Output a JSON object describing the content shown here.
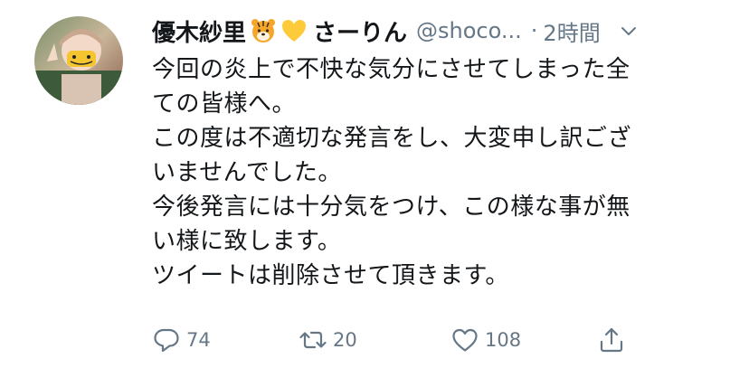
{
  "tweet": {
    "display_name": "優木紗里",
    "emoji_1": "tiger-face-emoji",
    "emoji_2": "yellow-heart-emoji",
    "nickname": "さーりん",
    "handle": "@shoco...",
    "time_separator": "·",
    "timestamp": "2時間",
    "lines": [
      "今回の炎上で不快な気分にさせてしまった全",
      "ての皆様へ。",
      "この度は不適切な発言をし、大変申し訳ござ",
      "いませんでした。",
      "今後発言には十分気をつけ、この様な事が無",
      "い様に致します。",
      "ツイートは削除させて頂きます。"
    ]
  },
  "actions": {
    "reply": {
      "icon": "reply-icon",
      "count": "74"
    },
    "retweet": {
      "icon": "retweet-icon",
      "count": "20"
    },
    "like": {
      "icon": "heart-icon",
      "count": "108"
    },
    "share": {
      "icon": "share-icon"
    }
  },
  "colors": {
    "text": "#14171a",
    "secondary": "#657786",
    "background": "#ffffff"
  }
}
